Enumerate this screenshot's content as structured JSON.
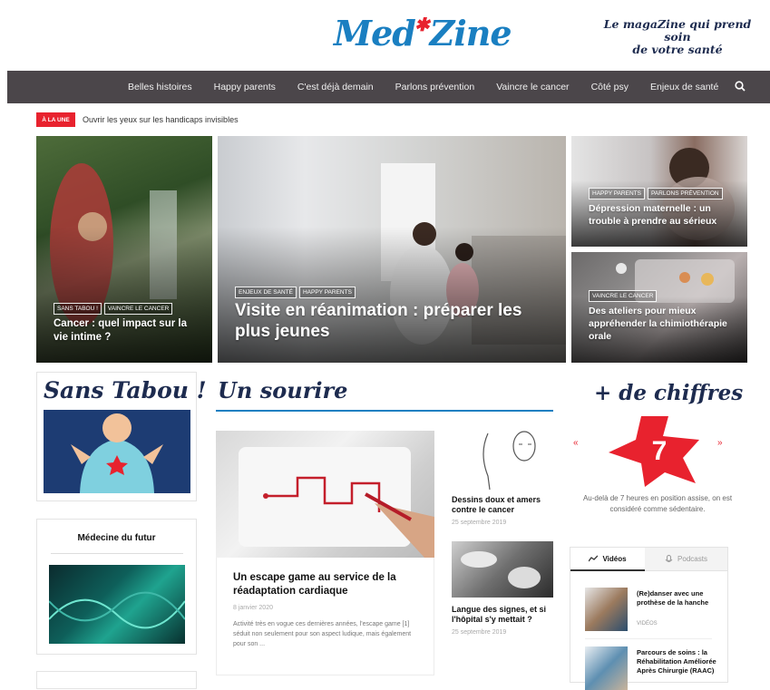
{
  "header": {
    "logo_left": "Med",
    "logo_right": "Zine",
    "tagline_line1": "Le magaZine qui prend soin",
    "tagline_line2": "de votre santé"
  },
  "nav": {
    "items": [
      "Belles histoires",
      "Happy parents",
      "C'est déjà demain",
      "Parlons prévention",
      "Vaincre le cancer",
      "Côté psy",
      "Enjeux de santé"
    ]
  },
  "une": {
    "badge": "À LA UNE",
    "text": "Ouvrir les yeux sur les handicaps invisibles"
  },
  "featured": [
    {
      "tags": [
        "SANS TABOU !",
        "VAINCRE LE CANCER"
      ],
      "title": "Cancer : quel impact sur la vie intime ?"
    },
    {
      "tags": [
        "ENJEUX DE SANTÉ",
        "HAPPY PARENTS"
      ],
      "title": "Visite en réanimation : préparer les plus jeunes"
    },
    {
      "tags": [
        "HAPPY PARENTS",
        "PARLONS PRÉVENTION"
      ],
      "title": "Dépression maternelle : un trouble à prendre au sérieux"
    },
    {
      "tags": [
        "VAINCRE LE CANCER"
      ],
      "title": "Des ateliers pour mieux appréhender la chimiothérapie orale"
    }
  ],
  "left_col": {
    "sans_tabou": "Sans Tabou !",
    "medecine_title": "Médecine du futur"
  },
  "sourire": {
    "heading": "Un sourire",
    "main_title": "Un escape game au service de la réadaptation cardiaque",
    "main_date": "8 janvier 2020",
    "main_excerpt": "Activité très en vogue ces dernières années, l'escape game [1] séduit non seulement pour son aspect ludique, mais également pour son ...",
    "side": [
      {
        "title": "Dessins doux et amers contre le cancer",
        "date": "25 septembre 2019"
      },
      {
        "title": "Langue des signes, et si l'hôpital s'y mettait ?",
        "date": "25 septembre 2019"
      }
    ]
  },
  "chiffres": {
    "heading": "+ de chiffres",
    "number": "7",
    "quote_open": "«",
    "quote_close": "»",
    "text": "Au-delà de 7 heures en position assise, on est considéré comme sédentaire."
  },
  "media_tabs": {
    "videos_label": "Vidéos",
    "podcasts_label": "Podcasts",
    "items": [
      {
        "title": "(Re)danser avec une prothèse de la hanche",
        "category": "VIDÉOS"
      },
      {
        "title": "Parcours de soins : la Réhabilitation Améliorée Après Chirurgie (RAAC)"
      }
    ]
  },
  "colors": {
    "brand_blue": "#1a7fc1",
    "brand_red": "#e8222e",
    "nav_bg": "#4b464a",
    "heading_navy": "#1d2b4f"
  },
  "icons": [
    "search-icon",
    "trend-icon",
    "podcast-icon"
  ]
}
